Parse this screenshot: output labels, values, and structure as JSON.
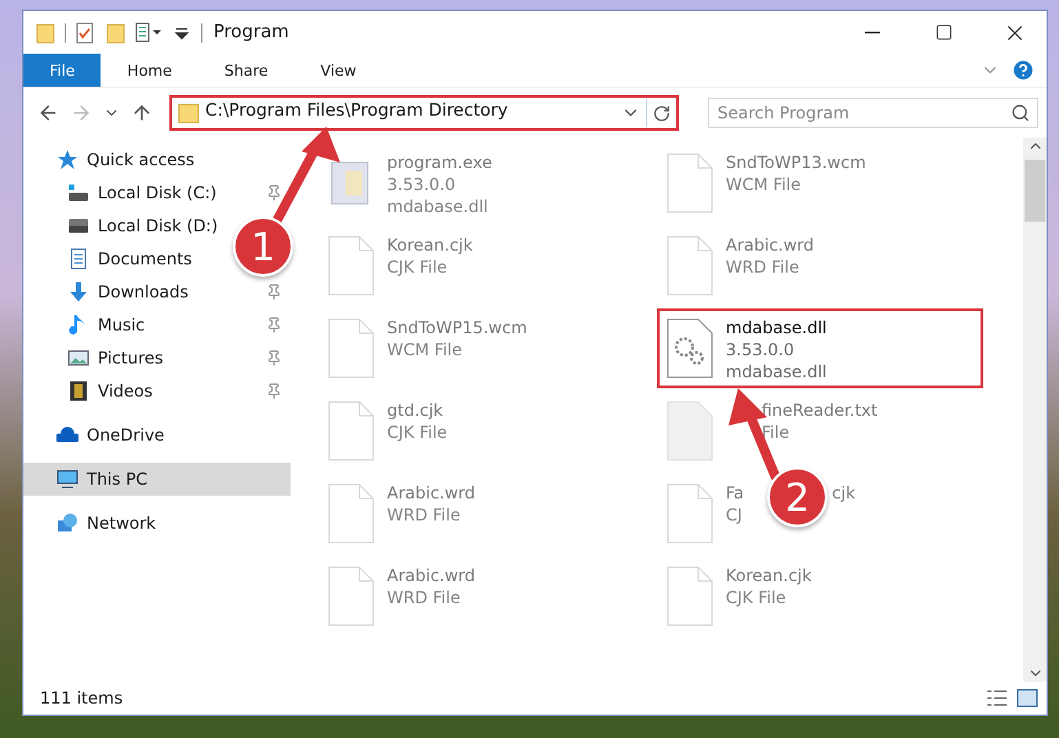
{
  "window": {
    "title": "Program"
  },
  "ribbon_tabs": [
    {
      "label": "File",
      "kind": "file",
      "selected": false
    },
    {
      "label": "Home",
      "kind": "tab",
      "selected": false
    },
    {
      "label": "Share",
      "kind": "tab",
      "selected": false
    },
    {
      "label": "View",
      "kind": "tab",
      "selected": false
    }
  ],
  "address": {
    "path": "C:\\Program Files\\Program Directory",
    "highlighted": true
  },
  "search": {
    "placeholder": "Search Program"
  },
  "sidebar": [
    {
      "label": "Quick access",
      "kind": "star",
      "selected": false,
      "children": [
        {
          "label": "Local Disk (C:)",
          "kind": "disk-c",
          "pinned": true,
          "selected": false
        },
        {
          "label": "Local Disk (D:)",
          "kind": "disk",
          "selected": false
        },
        {
          "label": "Documents",
          "kind": "documents",
          "selected": false
        },
        {
          "label": "Downloads",
          "kind": "downloads",
          "pinned": true,
          "selected": false
        },
        {
          "label": "Music",
          "kind": "music",
          "pinned": true,
          "selected": false
        },
        {
          "label": "Pictures",
          "kind": "pictures",
          "pinned": true,
          "selected": false
        },
        {
          "label": "Videos",
          "kind": "videos",
          "pinned": true,
          "selected": false
        }
      ]
    },
    {
      "label": "OneDrive",
      "kind": "cloud",
      "selected": false
    },
    {
      "label": "This PC",
      "kind": "pc",
      "selected": true
    },
    {
      "label": "Network",
      "kind": "network",
      "selected": false
    }
  ],
  "files": [
    {
      "name": "program.exe",
      "lines": [
        "3.53.0.0",
        "mdabase.dll"
      ],
      "kind": "exe",
      "faded": true,
      "highlighted": false
    },
    {
      "name": "SndToWP13.wcm",
      "lines": [
        "WCM File"
      ],
      "kind": "document",
      "faded": true,
      "highlighted": false
    },
    {
      "name": "Korean.cjk",
      "lines": [
        "CJK File"
      ],
      "kind": "document",
      "faded": true,
      "highlighted": false
    },
    {
      "name": "Arabic.wrd",
      "lines": [
        "WRD File"
      ],
      "kind": "document",
      "faded": true,
      "highlighted": false
    },
    {
      "name": "SndToWP15.wcm",
      "lines": [
        "WCM File"
      ],
      "kind": "document",
      "faded": true,
      "highlighted": false
    },
    {
      "name": "mdabase.dll",
      "lines": [
        "3.53.0.0",
        "mdabase.dll"
      ],
      "kind": "dll",
      "faded": false,
      "highlighted": true
    },
    {
      "name": "gtd.cjk",
      "lines": [
        "CJK File"
      ],
      "kind": "document",
      "faded": true,
      "highlighted": false
    },
    {
      "name": "fineReader.txt",
      "lines": [
        "File"
      ],
      "kind": "text",
      "faded": true,
      "highlighted": false,
      "covered": true
    },
    {
      "name": "Arabic.wrd",
      "lines": [
        "WRD File"
      ],
      "kind": "document",
      "faded": true,
      "highlighted": false
    },
    {
      "name": "Fa",
      "name_tail": "cjk",
      "lines": [
        "CJ"
      ],
      "kind": "document",
      "faded": true,
      "highlighted": false
    },
    {
      "name": "Arabic.wrd",
      "lines": [
        "WRD File"
      ],
      "kind": "document",
      "faded": true,
      "highlighted": false
    },
    {
      "name": "Korean.cjk",
      "lines": [
        "CJK File"
      ],
      "kind": "document",
      "faded": true,
      "highlighted": false
    }
  ],
  "status_bar": {
    "count": "111 items"
  },
  "annotations": [
    {
      "label": "1"
    },
    {
      "label": "2"
    }
  ]
}
